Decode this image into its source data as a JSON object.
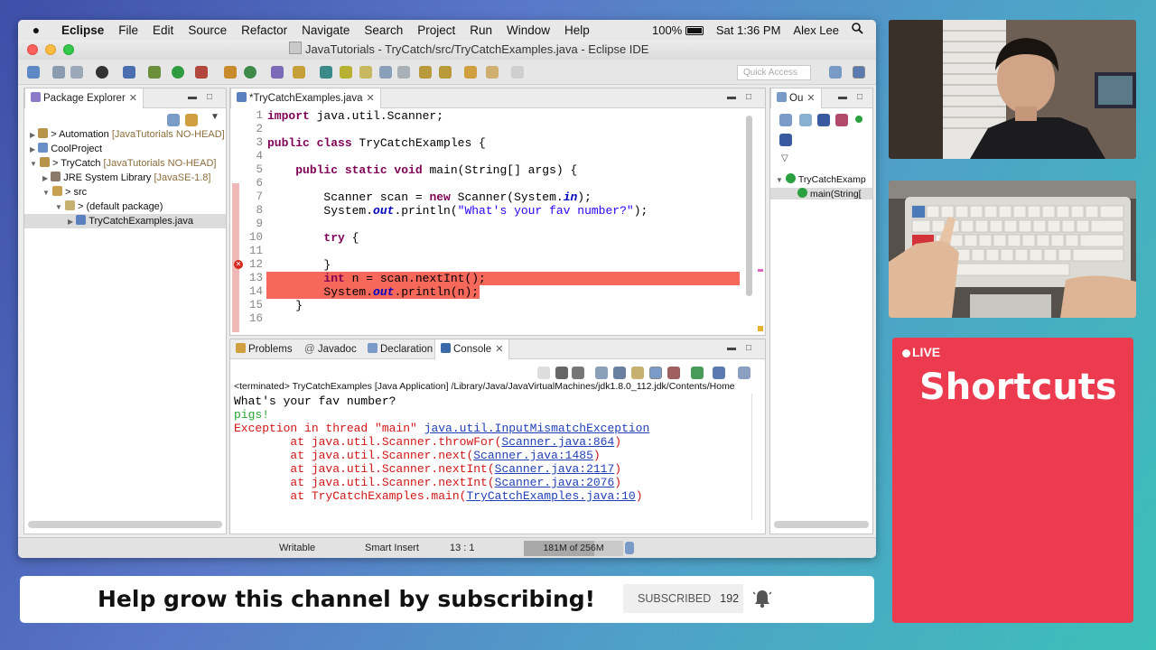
{
  "menubar": {
    "apple_icon": "apple-icon",
    "items": [
      "Eclipse",
      "File",
      "Edit",
      "Source",
      "Refactor",
      "Navigate",
      "Search",
      "Project",
      "Run",
      "Window",
      "Help"
    ],
    "battery": "100%",
    "clock": "Sat 1:36 PM",
    "user": "Alex Lee"
  },
  "window": {
    "title": "JavaTutorials - TryCatch/src/TryCatchExamples.java - Eclipse IDE",
    "quick_access_placeholder": "Quick Access"
  },
  "package_explorer": {
    "tab_label": "Package Explorer",
    "items": [
      {
        "label": "> Automation",
        "decoration": "[JavaTutorials NO-HEAD]"
      },
      {
        "label": "CoolProject",
        "decoration": ""
      },
      {
        "label": "> TryCatch",
        "decoration": "[JavaTutorials NO-HEAD]"
      },
      {
        "label": "JRE System Library",
        "decoration": "[JavaSE-1.8]"
      },
      {
        "label": "> src",
        "decoration": ""
      },
      {
        "label": "> (default package)",
        "decoration": ""
      },
      {
        "label": "TryCatchExamples.java",
        "decoration": ""
      }
    ]
  },
  "editor": {
    "tab_label": "*TryCatchExamples.java",
    "line_numbers": [
      "1",
      "2",
      "3",
      "4",
      "5",
      "6",
      "7",
      "8",
      "9",
      "10",
      "11",
      "12",
      "13",
      "14",
      "15",
      "16"
    ],
    "lines": {
      "l1_kw": "import",
      "l1_rest": " java.util.Scanner;",
      "l3_kw": "public class",
      "l3_rest": " TryCatchExamples {",
      "l5_kw": "public static void",
      "l5_rest": " main(String[] args) {",
      "l7_a": "Scanner scan = ",
      "l7_kw": "new",
      "l7_b": " Scanner(System.",
      "l7_fld": "in",
      "l7_c": ");",
      "l8_a": "System.",
      "l8_fld": "out",
      "l8_b": ".println(",
      "l8_str": "\"What's your fav number?\"",
      "l8_c": ");",
      "l10_kw": "try",
      "l10_rest": " {",
      "l12": "}",
      "l13_kw": "int",
      "l13_rest": " n = scan.nextInt();",
      "l14_a": "System.",
      "l14_fld": "out",
      "l14_b": ".println(n);",
      "l15": "}"
    }
  },
  "console": {
    "tabs": [
      "Problems",
      "Javadoc",
      "Declaration",
      "Console"
    ],
    "path": "<terminated> TryCatchExamples [Java Application] /Library/Java/JavaVirtualMachines/jdk1.8.0_112.jdk/Contents/Home",
    "output_line": "What's your fav number?",
    "input_line": "pigs!",
    "exception_prefix": "Exception in thread \"main\" ",
    "exception_link": "java.util.InputMismatchException",
    "stack": [
      {
        "prefix": "        at java.util.Scanner.throwFor(",
        "link": "Scanner.java:864",
        "suffix": ")"
      },
      {
        "prefix": "        at java.util.Scanner.next(",
        "link": "Scanner.java:1485",
        "suffix": ")"
      },
      {
        "prefix": "        at java.util.Scanner.nextInt(",
        "link": "Scanner.java:2117",
        "suffix": ")"
      },
      {
        "prefix": "        at java.util.Scanner.nextInt(",
        "link": "Scanner.java:2076",
        "suffix": ")"
      },
      {
        "prefix": "        at TryCatchExamples.main(",
        "link": "TryCatchExamples.java:10",
        "suffix": ")"
      }
    ]
  },
  "outline": {
    "tab_label": "Ou",
    "items": [
      "TryCatchExamp",
      "main(String["
    ]
  },
  "statusbar": {
    "mode": "Writable",
    "insert": "Smart Insert",
    "position": "13 : 1",
    "heap": "181M of 256M",
    "heap_used_fraction": 0.707
  },
  "live": {
    "badge": "LIVE",
    "title": "Shortcuts"
  },
  "subscribe": {
    "message": "Help grow this channel by subscribing!",
    "button": "SUBSCRIBED",
    "count": "192"
  },
  "colors": {
    "error_highlight": "#f6685a",
    "live_card": "#ec3a4f",
    "keyword": "#7f0055",
    "string": "#2a00ff"
  }
}
